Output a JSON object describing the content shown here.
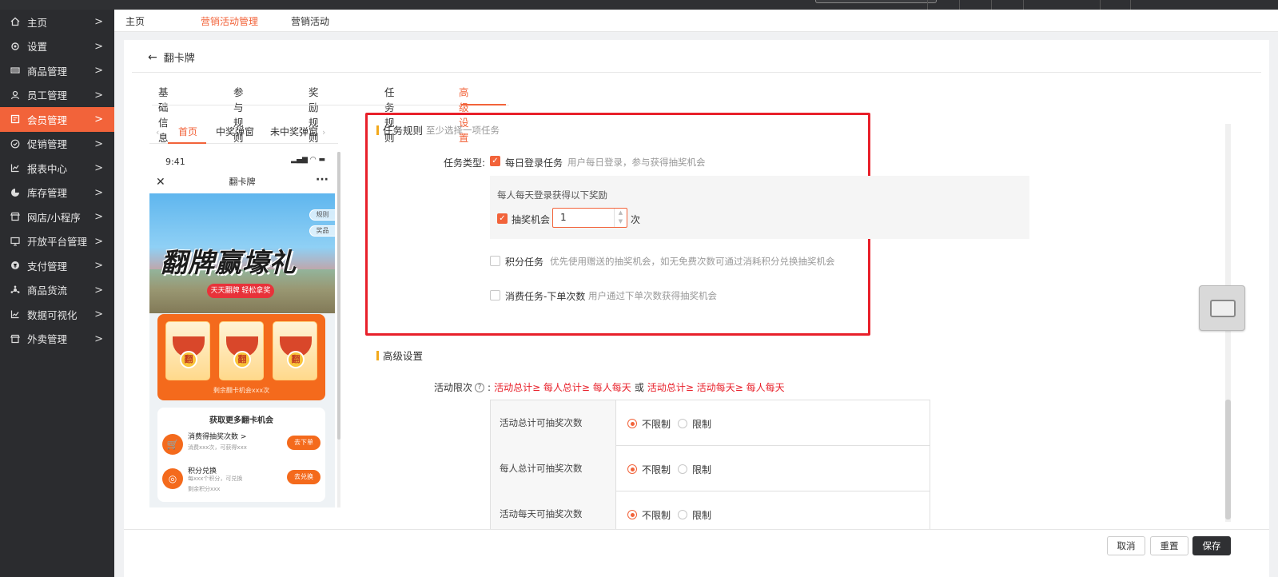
{
  "sidebar": {
    "items": [
      {
        "label": "主页",
        "icon": "home-icon"
      },
      {
        "label": "设置",
        "icon": "gear-icon"
      },
      {
        "label": "商品管理",
        "icon": "barcode-icon"
      },
      {
        "label": "员工管理",
        "icon": "staff-icon"
      },
      {
        "label": "会员管理",
        "icon": "member-icon",
        "active": true
      },
      {
        "label": "促销管理",
        "icon": "promo-icon"
      },
      {
        "label": "报表中心",
        "icon": "chart-icon"
      },
      {
        "label": "库存管理",
        "icon": "pie-icon"
      },
      {
        "label": "网店/小程序",
        "icon": "store-icon"
      },
      {
        "label": "开放平台管理",
        "icon": "monitor-icon"
      },
      {
        "label": "支付管理",
        "icon": "payment-icon"
      },
      {
        "label": "商品货流",
        "icon": "network-icon"
      },
      {
        "label": "数据可视化",
        "icon": "line-chart-icon"
      },
      {
        "label": "外卖管理",
        "icon": "takeout-icon"
      }
    ]
  },
  "breadcrumb": {
    "home": "主页",
    "marketing_mgmt": "营销活动管理",
    "marketing_activity": "营销活动"
  },
  "page": {
    "back_title": "翻卡牌",
    "tabs": [
      "基础信息",
      "参与规则",
      "奖励规则",
      "任务规则",
      "高级设置"
    ],
    "active_tab": "高级设置"
  },
  "preview": {
    "tabs": [
      "首页",
      "中奖弹窗",
      "未中奖弹窗"
    ],
    "time": "9:41",
    "title": "翻卡牌",
    "side_rules": "规则",
    "side_prizes": "奖品",
    "banner_text": "翻牌赢壕礼",
    "banner_pill": "天天翻牌 轻松拿奖",
    "card_char": "翻",
    "remain_text": "剩余翻卡机会xxx次",
    "more_title": "获取更多翻卡机会",
    "task1": {
      "title": "消费得抽奖次数 >",
      "desc": "消费xxx次，可获得xxx",
      "btn": "去下单"
    },
    "task2": {
      "title": "积分兑换",
      "desc": "每xxx个积分，可兑换",
      "desc2": "剩余积分xxx",
      "btn": "去兑换"
    }
  },
  "task_rules": {
    "title": "任务规则",
    "subtitle": "至少选择一项任务",
    "type_label": "任务类型:",
    "daily_login": {
      "label": "每日登录任务",
      "hint": "用户每日登录，参与获得抽奖机会",
      "checked": true
    },
    "reward_title": "每人每天登录获得以下奖励",
    "lottery": {
      "label": "抽奖机会",
      "value": "1",
      "unit": "次",
      "checked": true
    },
    "points_task": {
      "label": "积分任务",
      "hint": "优先使用赠送的抽奖机会，如无免费次数可通过消耗积分兑换抽奖机会",
      "checked": false
    },
    "consume_task": {
      "label": "消费任务-下单次数",
      "hint": "用户通过下单次数获得抽奖机会",
      "checked": false
    }
  },
  "advanced": {
    "title": "高级设置",
    "limit_label": "活动限次",
    "limit_rule_a": "活动总计≥ 每人总计≥ 每人每天",
    "limit_or": "或",
    "limit_rule_b": "活动总计≥ 活动每天≥ 每人每天",
    "rows": [
      {
        "name": "活动总计可抽奖次数",
        "unlimited": "不限制",
        "limited": "限制",
        "selected": "unlimited"
      },
      {
        "name": "每人总计可抽奖次数",
        "unlimited": "不限制",
        "limited": "限制",
        "selected": "unlimited"
      },
      {
        "name": "活动每天可抽奖次数",
        "unlimited": "不限制",
        "limited": "限制",
        "selected": "unlimited"
      }
    ]
  },
  "footer": {
    "cancel": "取消",
    "reset": "重置",
    "save": "保存"
  },
  "colors": {
    "accent": "#f2633a",
    "sidebar_bg": "#2b2c2f",
    "highlight_box": "#e8202a"
  }
}
